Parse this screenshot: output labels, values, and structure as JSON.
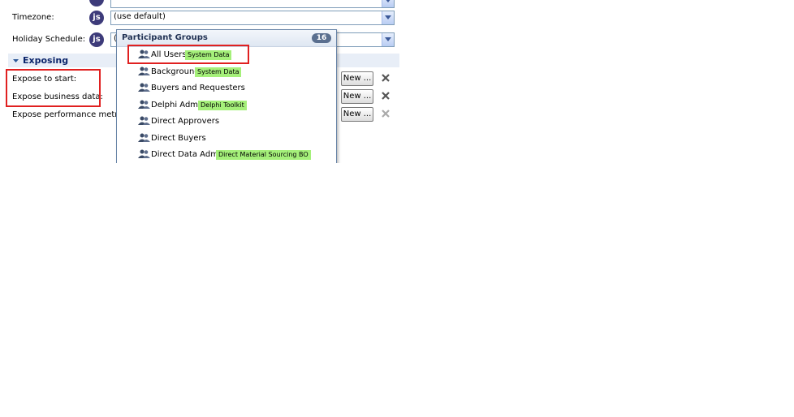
{
  "form": {
    "timezone_label": "Timezone:",
    "timezone_value": "(use default)",
    "holiday_label": "Holiday Schedule:",
    "holiday_value": "(",
    "js_badge": "js"
  },
  "exposing": {
    "section_title": "Exposing",
    "expose_start_label": "Expose to start:",
    "expose_data_label": "Expose business data:",
    "expose_metrics_label": "Expose performance metrics:",
    "new_button_label": "New ..."
  },
  "participant_groups": {
    "title": "Participant Groups",
    "count": "16",
    "items": [
      {
        "name": "All Users",
        "tag": "System Data"
      },
      {
        "name": "Background",
        "tag": "System Data"
      },
      {
        "name": "Buyers and Requesters",
        "tag": ""
      },
      {
        "name": "Delphi Admin",
        "tag": "Delphi Toolkit"
      },
      {
        "name": "Direct Approvers",
        "tag": ""
      },
      {
        "name": "Direct Buyers",
        "tag": ""
      },
      {
        "name": "Direct Data Admin",
        "tag": "Direct Material Sourcing BO"
      }
    ]
  },
  "colors": {
    "tag_bg": "#a5f07a",
    "highlight_box": "#e02020",
    "js_badge": "#3d3b7a"
  },
  "icons": [
    "js-badge",
    "dropdown-arrow-icon",
    "collapse-triangle-icon",
    "group-icon",
    "delete-x-icon"
  ]
}
